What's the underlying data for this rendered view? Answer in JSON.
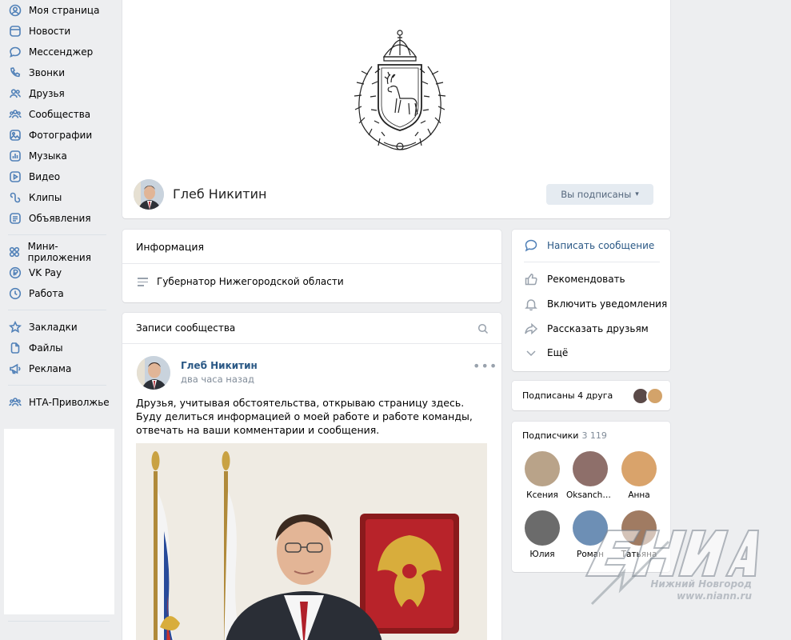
{
  "sidebar": {
    "items": [
      {
        "label": "Моя страница",
        "icon": "user-circle-icon"
      },
      {
        "label": "Новости",
        "icon": "news-icon"
      },
      {
        "label": "Мессенджер",
        "icon": "message-icon"
      },
      {
        "label": "Звонки",
        "icon": "phone-icon"
      },
      {
        "label": "Друзья",
        "icon": "friends-icon"
      },
      {
        "label": "Сообщества",
        "icon": "communities-icon"
      },
      {
        "label": "Фотографии",
        "icon": "photo-icon"
      },
      {
        "label": "Музыка",
        "icon": "music-icon"
      },
      {
        "label": "Видео",
        "icon": "video-icon"
      },
      {
        "label": "Клипы",
        "icon": "clips-icon"
      },
      {
        "label": "Объявления",
        "icon": "ads-board-icon"
      }
    ],
    "items2": [
      {
        "label": "Мини-приложения",
        "icon": "apps-icon"
      },
      {
        "label": "VK Pay",
        "icon": "vkpay-icon"
      },
      {
        "label": "Работа",
        "icon": "work-icon"
      }
    ],
    "items3": [
      {
        "label": "Закладки",
        "icon": "star-icon"
      },
      {
        "label": "Файлы",
        "icon": "file-icon"
      },
      {
        "label": "Реклама",
        "icon": "megaphone-icon"
      }
    ],
    "items4": [
      {
        "label": "НТА-Приволжье",
        "icon": "group-icon"
      }
    ]
  },
  "profile": {
    "name": "Глеб Никитин",
    "subscribe_button": "Вы подписаны"
  },
  "info": {
    "title": "Информация",
    "status": "Губернатор Нижегородской области"
  },
  "posts": {
    "tab": "Записи сообщества",
    "author": "Глеб Никитин",
    "time": "два часа назад",
    "text_line1": "Друзья, учитывая обстоятельства, открываю страницу здесь.",
    "text_line2": "Буду делиться информацией о моей работе и работе команды, отвечать на ваши комментарии и сообщения."
  },
  "actions": {
    "write": "Написать сообщение",
    "recommend": "Рекомендовать",
    "notify": "Включить уведомления",
    "share": "Рассказать друзьям",
    "more": "Ещё"
  },
  "friends": {
    "label": "Подписаны 4 друга"
  },
  "subscribers": {
    "label": "Подписчики",
    "count": "3 119",
    "items": [
      {
        "name": "Ксения",
        "color": "#b9a389"
      },
      {
        "name": "Oksanchu...",
        "color": "#8e6f6a"
      },
      {
        "name": "Анна",
        "color": "#d9a36b"
      },
      {
        "name": "Юлия",
        "color": "#6b6b6b"
      },
      {
        "name": "Роман",
        "color": "#6d8fb5"
      },
      {
        "name": "Татьяна",
        "color": "#a07b62"
      }
    ]
  },
  "watermark": {
    "brand": "НИА",
    "line1": "Нижний Новгород",
    "line2": "www.niann.ru"
  }
}
